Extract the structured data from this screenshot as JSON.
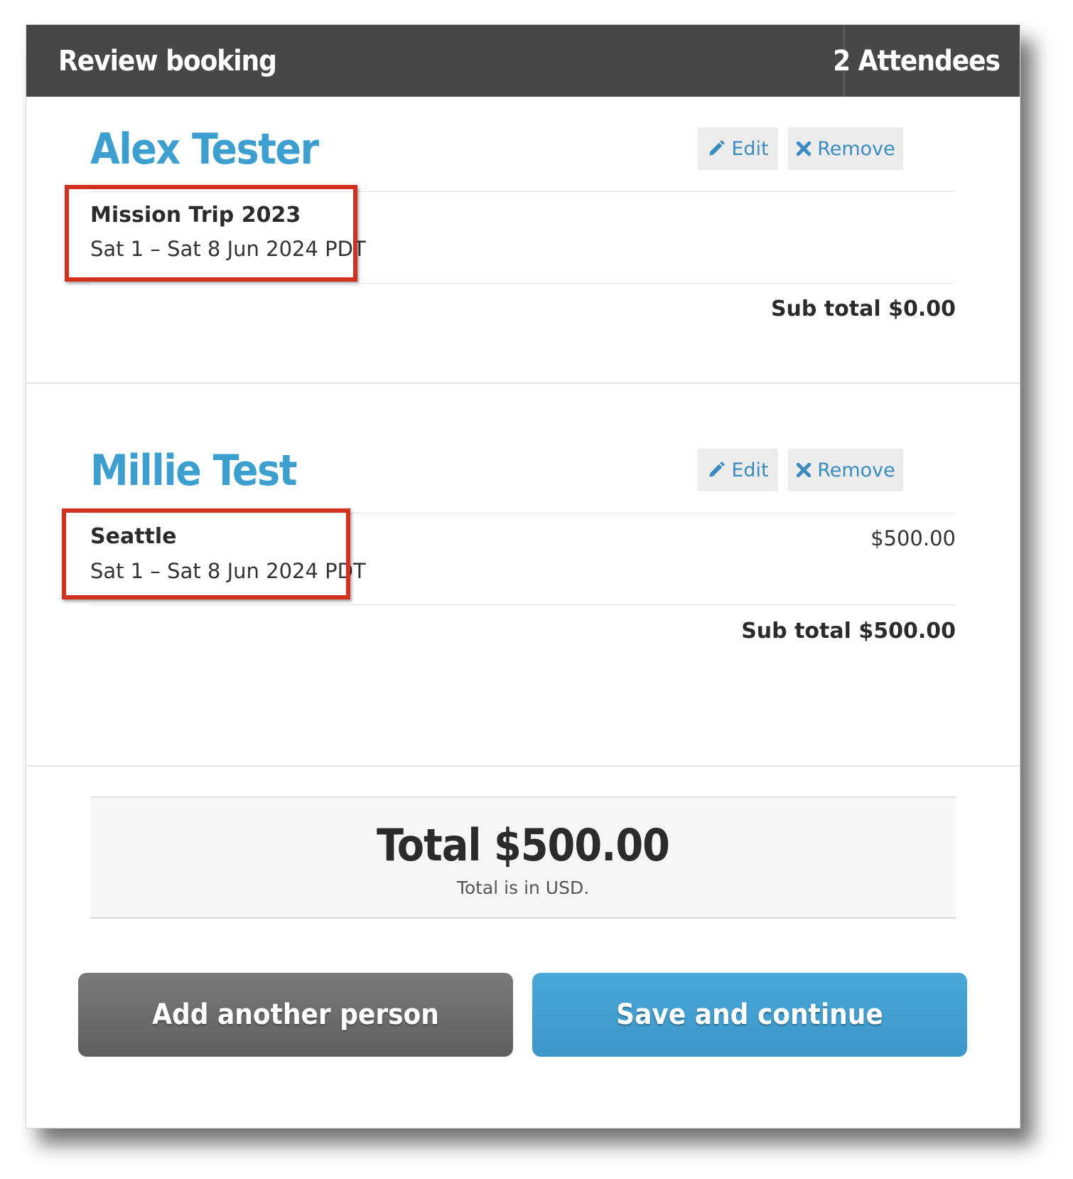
{
  "header": {
    "title": "Review booking",
    "attendees": "2 Attendees"
  },
  "people": [
    {
      "name": "Alex Tester",
      "edit_label": "Edit",
      "remove_label": "Remove",
      "item_title": "Mission Trip 2023",
      "item_dates": "Sat 1 – Sat 8 Jun 2024 PDT",
      "subtotal": "Sub total $0.00"
    },
    {
      "name": "Millie Test",
      "edit_label": "Edit",
      "remove_label": "Remove",
      "item_title": "Seattle",
      "item_dates": "Sat 1 – Sat 8 Jun 2024 PDT",
      "item_price": "$500.00",
      "subtotal": "Sub total $500.00"
    }
  ],
  "total": {
    "amount": "Total $500.00",
    "note": "Total is in USD."
  },
  "actions": {
    "add_person": "Add another person",
    "save_continue": "Save and continue"
  },
  "icons": {
    "edit": "pencil-icon",
    "remove": "close-icon"
  },
  "colors": {
    "header_bg": "#474747",
    "accent_blue": "#3d9fd0",
    "highlight_red": "#d2311f",
    "secondary_button": "#6b6b6b"
  }
}
